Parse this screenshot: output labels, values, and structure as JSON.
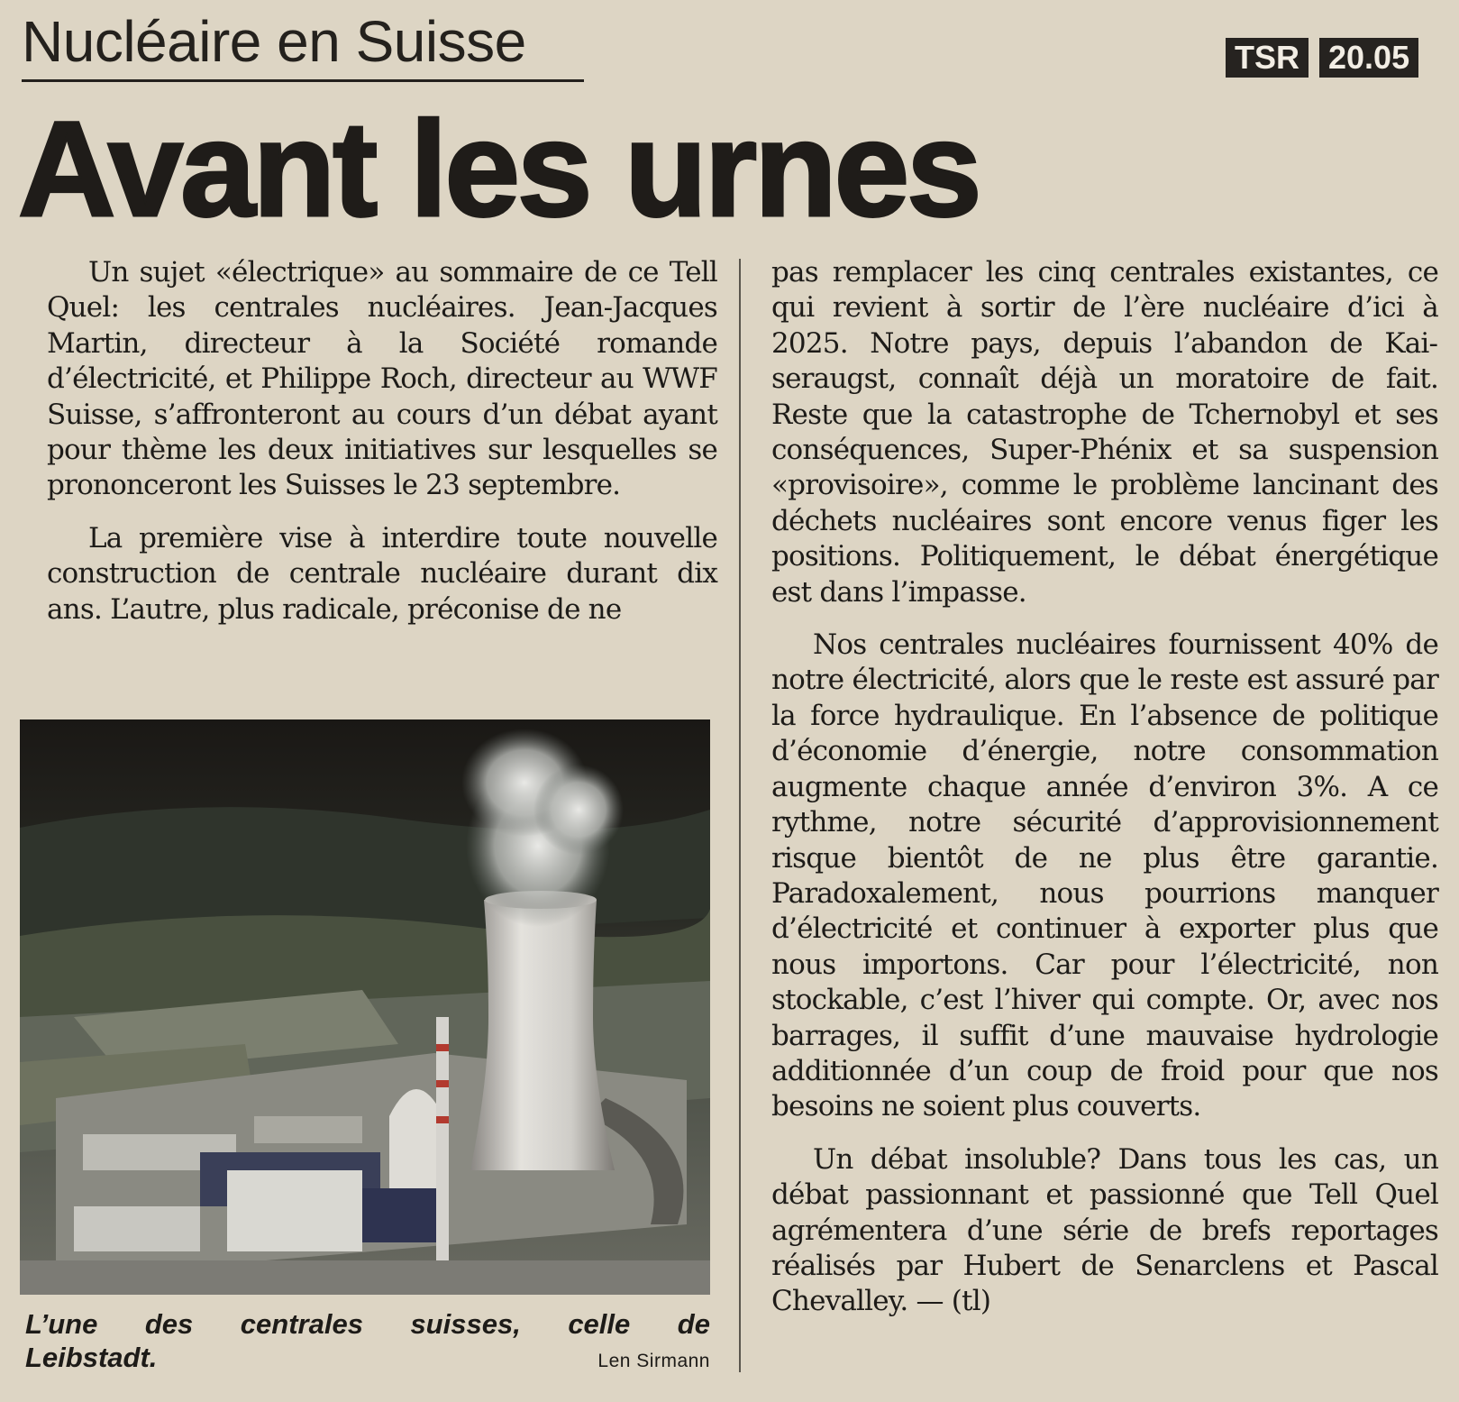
{
  "kicker": "Nucléaire en Suisse",
  "badges": {
    "channel": "TSR",
    "time": "20.05"
  },
  "headline": "Avant les urnes",
  "left_column": {
    "p1": "Un sujet «électrique» au sommaire de ce Tell Quel: les centrales nucléaires. Jean-Jac­ques Martin, directeur à la Société romande d’électricité, et Philippe Roch, directeur au WWF Suisse, s’affronteront au cours d’un débat ayant pour thème les deux initiatives sur lesquelles se prononceront les Suisses le 23 septembre.",
    "p2": "La première vise à interdire toute nouvelle construction de centrale nucléaire durant dix ans. L’autre, plus radicale, préconise de ne"
  },
  "right_column": {
    "p1": "pas remplacer les cinq centrales existantes, ce qui revient à sortir de l’ère nucléaire d’ici à 2025. Notre pays, depuis l’abandon de Kai­seraugst, connaît déjà un moratoire de fait. Reste que la catastrophe de Tchernobyl et ses conséquences, Super-Phénix et sa sus­pension «provisoire», comme le problème lancinant des déchets nucléaires sont encore venus figer les positions. Politiquement, le débat énergétique est dans l’impasse.",
    "p2": "Nos centrales nucléaires fournissent 40% de notre électricité, alors que le reste est as­suré par la force hydraulique. En l’absence de politique d’économie d’énergie, notre con­sommation augmente chaque année d’envi­ron 3%. A ce rythme, notre sécurité d’appro­visionnement risque bientôt de ne plus être garantie. Paradoxalement, nous pourrions manquer d’électricité et continuer à exporter plus que nous importons. Car pour l’électri­cité, non stockable, c’est l’hiver qui compte. Or, avec nos barrages, il suffit d’une mau­vaise hydrologie additionnée d’un coup de froid pour que nos besoins ne soient plus cou­verts.",
    "p3": "Un débat insoluble? Dans tous les cas, un débat passionnant et passionné que Tell Quel agrémentera d’une série de brefs reportages réalisés par Hubert de Senarclens et Pascal Chevalley. — (tl)"
  },
  "photo": {
    "subject": "aerial-photo-nuclear-plant",
    "caption_words": [
      "L’une",
      "des",
      "centrales",
      "suisses,",
      "celle",
      "de"
    ],
    "caption_line2": "Leibstadt.",
    "credit": "Len Sirmann"
  }
}
